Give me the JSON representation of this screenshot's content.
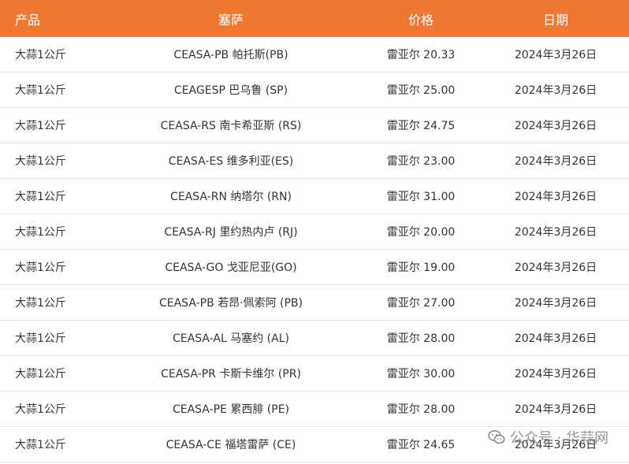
{
  "table": {
    "headers": {
      "product": "产品",
      "ceasa": "塞萨",
      "price": "价格",
      "date": "日期"
    },
    "rows": [
      {
        "product": "大蒜1公斤",
        "ceasa": "CEASA-PB 帕托斯(PB)",
        "price": "雷亚尔 20.33",
        "date": "2024年3月26日"
      },
      {
        "product": "大蒜1公斤",
        "ceasa": "CEAGESP 巴乌鲁 (SP)",
        "price": "雷亚尔 25.00",
        "date": "2024年3月26日"
      },
      {
        "product": "大蒜1公斤",
        "ceasa": "CEASA-RS 南卡希亚斯 (RS)",
        "price": "雷亚尔 24.75",
        "date": "2024年3月26日"
      },
      {
        "product": "大蒜1公斤",
        "ceasa": "CEASA-ES 维多利亚(ES)",
        "price": "雷亚尔 23.00",
        "date": "2024年3月26日"
      },
      {
        "product": "大蒜1公斤",
        "ceasa": "CEASA-RN 纳塔尔 (RN)",
        "price": "雷亚尔 31.00",
        "date": "2024年3月26日"
      },
      {
        "product": "大蒜1公斤",
        "ceasa": "CEASA-RJ 里约热内卢 (RJ)",
        "price": "雷亚尔 20.00",
        "date": "2024年3月26日"
      },
      {
        "product": "大蒜1公斤",
        "ceasa": "CEASA-GO 戈亚尼亚(GO)",
        "price": "雷亚尔 19.00",
        "date": "2024年3月26日"
      },
      {
        "product": "大蒜1公斤",
        "ceasa": "CEASA-PB 若昂·佩索阿 (PB)",
        "price": "雷亚尔 27.00",
        "date": "2024年3月26日"
      },
      {
        "product": "大蒜1公斤",
        "ceasa": "CEASA-AL 马塞约 (AL)",
        "price": "雷亚尔 28.00",
        "date": "2024年3月26日"
      },
      {
        "product": "大蒜1公斤",
        "ceasa": "CEASA-PR 卡斯卡维尔 (PR)",
        "price": "雷亚尔 30.00",
        "date": "2024年3月26日"
      },
      {
        "product": "大蒜1公斤",
        "ceasa": "CEASA-PE 累西腓 (PE)",
        "price": "雷亚尔 28.00",
        "date": "2024年3月26日"
      },
      {
        "product": "大蒜1公斤",
        "ceasa": "CEASA-CE 福塔雷萨 (CE)",
        "price": "雷亚尔 24.65",
        "date": "2024年3月26日"
      }
    ]
  },
  "watermark": {
    "text": "公众号 · 华蒜网",
    "icon": "wechat-icon"
  },
  "colors": {
    "header_bg": "#f07833",
    "header_text": "#ffffff",
    "row_border": "#e6e6e6",
    "text": "#333333"
  }
}
